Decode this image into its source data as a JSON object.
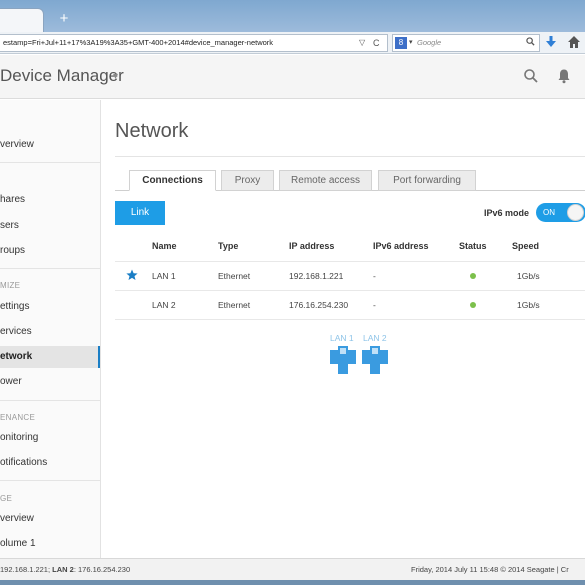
{
  "browser": {
    "url": "estamp=Fri+Jul+11+17%3A19%3A35+GMT-400+2014#device_manager-network",
    "new_tab": "+",
    "url_dropdown": "▽",
    "reload": "C",
    "search_placeholder": "Google",
    "search_engine_letter": "8",
    "search_dropdown": "▾",
    "search_go": "⌕",
    "download_icon": "download-icon",
    "home_icon": "home-icon"
  },
  "app": {
    "title": "Device Manager",
    "caret": "▾",
    "search_icon": "search-icon",
    "bell_icon": "bell-icon"
  },
  "sidebar": {
    "items": [
      {
        "label": "verview",
        "active": false
      },
      {
        "label": "hares",
        "active": false
      },
      {
        "label": "sers",
        "active": false
      },
      {
        "label": "roups",
        "active": false
      },
      {
        "label": "ettings",
        "active": false
      },
      {
        "label": "ervices",
        "active": false
      },
      {
        "label": "etwork",
        "active": true
      },
      {
        "label": "ower",
        "active": false
      },
      {
        "label": "onitoring",
        "active": false
      },
      {
        "label": "otifications",
        "active": false
      },
      {
        "label": "verview",
        "active": false
      },
      {
        "label": "olume 1",
        "active": false
      }
    ],
    "sections": [
      "MIZE",
      "ENANCE",
      "GE"
    ]
  },
  "main": {
    "title": "Network",
    "tabs": [
      {
        "label": "Connections",
        "active": true
      },
      {
        "label": "Proxy",
        "active": false
      },
      {
        "label": "Remote access",
        "active": false
      },
      {
        "label": "Port forwarding",
        "active": false
      }
    ],
    "link_button": "Link",
    "ipv6_label": "IPv6 mode",
    "ipv6_toggle": "ON",
    "ipv6_enabled": true,
    "columns": [
      "Name",
      "Type",
      "IP address",
      "IPv6 address",
      "Status",
      "Speed"
    ],
    "rows": [
      {
        "default": true,
        "name": "LAN 1",
        "type": "Ethernet",
        "ip": "192.168.1.221",
        "ipv6": "-",
        "status": "connected",
        "speed": "1Gb/s"
      },
      {
        "default": false,
        "name": "LAN 2",
        "type": "Ethernet",
        "ip": "176.16.254.230",
        "ipv6": "-",
        "status": "connected",
        "speed": "1Gb/s"
      }
    ],
    "ports": [
      {
        "label": "LAN 1"
      },
      {
        "label": "LAN 2"
      }
    ],
    "status_color": "#7cc04b",
    "accent_color": "#1e9de6"
  },
  "statusbar": {
    "left_prefix": "192.168.1.221; ",
    "left_lan2_label": "LAN 2",
    "left_lan2_value": ": 176.16.254.230",
    "right": "Friday, 2014 July 11   15:48   © 2014 Seagate | Cr"
  }
}
